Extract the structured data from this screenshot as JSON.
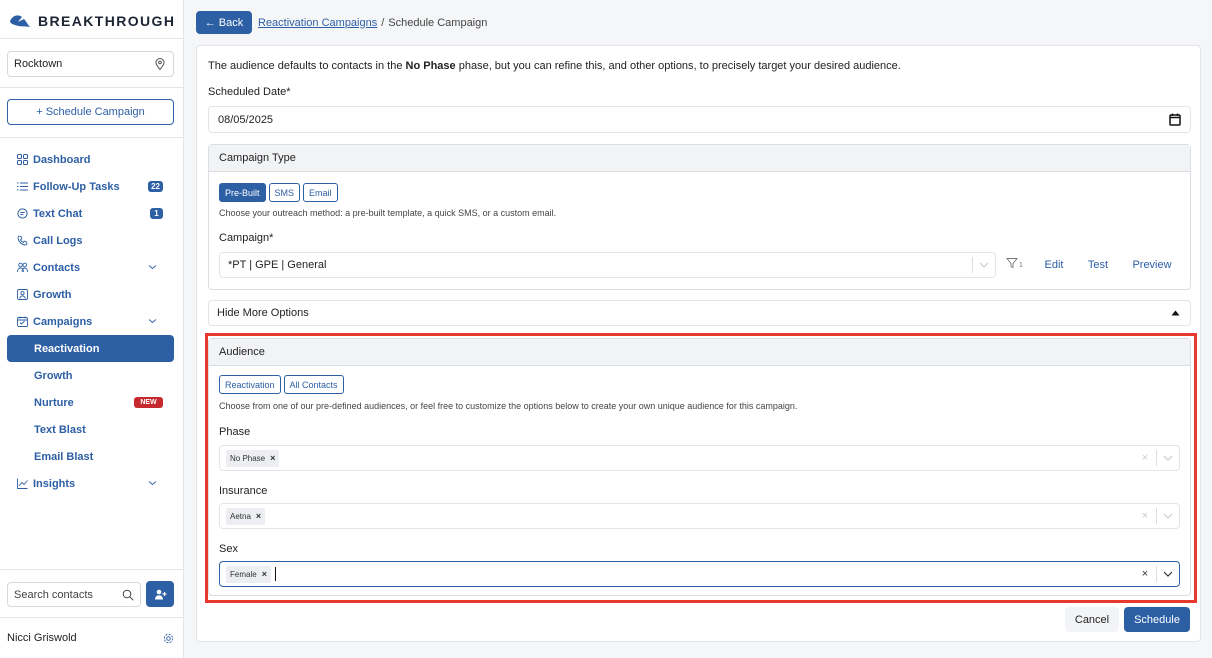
{
  "app": {
    "name": "BREAKTHROUGH"
  },
  "sidebar": {
    "location": "Rocktown",
    "schedule_button": "+ Schedule Campaign",
    "nav": [
      {
        "label": "Dashboard",
        "icon": "grid-icon"
      },
      {
        "label": "Follow-Up Tasks",
        "icon": "list-icon",
        "badge": "22"
      },
      {
        "label": "Text Chat",
        "icon": "chat-icon",
        "badge": "1"
      },
      {
        "label": "Call Logs",
        "icon": "phone-icon"
      },
      {
        "label": "Contacts",
        "icon": "users-icon"
      },
      {
        "label": "Growth",
        "icon": "person-icon"
      },
      {
        "label": "Campaigns",
        "icon": "calendar-icon"
      }
    ],
    "campaign_sub": [
      {
        "label": "Reactivation"
      },
      {
        "label": "Growth"
      },
      {
        "label": "Nurture",
        "badge": "NEW"
      },
      {
        "label": "Text Blast"
      },
      {
        "label": "Email Blast"
      }
    ],
    "insights": "Insights",
    "search_placeholder": "Search contacts",
    "user_name": "Nicci Griswold"
  },
  "header": {
    "back_label": "← Back",
    "breadcrumb_link": "Reactivation Campaigns",
    "breadcrumb_sep": "/",
    "breadcrumb_current": "Schedule Campaign"
  },
  "form": {
    "intro_pre": "The audience defaults to contacts in the ",
    "intro_bold": "No Phase",
    "intro_post": " phase, but you can refine this, and other options, to precisely target your desired audience.",
    "date_label": "Scheduled Date*",
    "date_value": "08/05/2025",
    "campaign_type": {
      "title": "Campaign Type",
      "options": [
        "Pre-Built",
        "SMS",
        "Email"
      ],
      "selected": "Pre-Built",
      "help": "Choose your outreach method: a pre-built template, a quick SMS, or a custom email.",
      "campaign_label": "Campaign*",
      "campaign_value": "*PT | GPE | General",
      "filter_count": "1",
      "actions": [
        "Edit",
        "Test",
        "Preview"
      ]
    },
    "more_options": "Hide More Options",
    "audience": {
      "title": "Audience",
      "presets": [
        "Reactivation",
        "All Contacts"
      ],
      "help": "Choose from one of our pre-defined audiences, or feel free to customize the options below to create your own unique audience for this campaign.",
      "phase_label": "Phase",
      "phase_tag": "No Phase",
      "insurance_label": "Insurance",
      "insurance_tag": "Aetna",
      "sex_label": "Sex",
      "sex_tag": "Female",
      "tag_remove": "×",
      "clear": "×"
    },
    "cancel": "Cancel",
    "schedule": "Schedule"
  },
  "colors": {
    "primary": "#2d5fa5",
    "highlight": "#e8392e",
    "new_badge": "#c62a2f"
  }
}
